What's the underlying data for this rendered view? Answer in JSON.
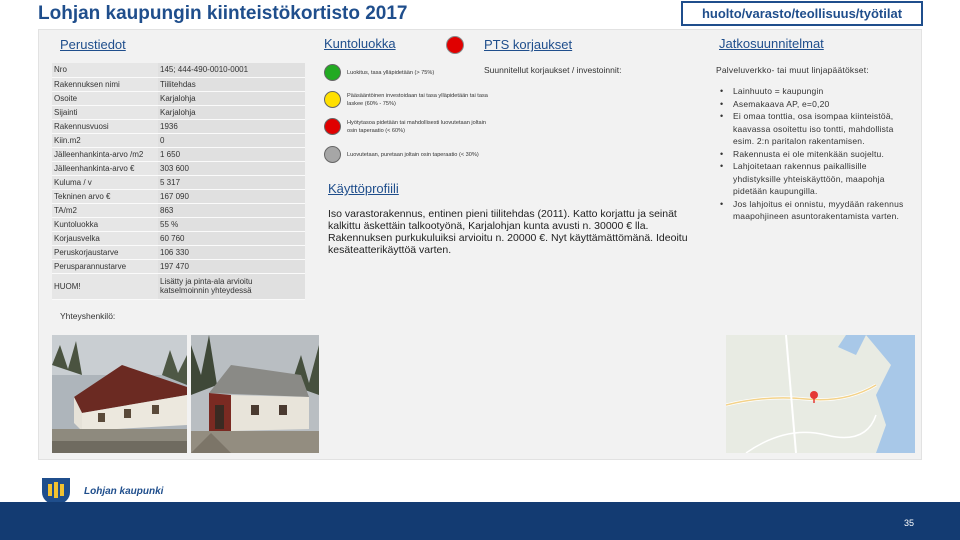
{
  "header": {
    "title": "Lohjan kaupungin kiinteistökortisto 2017",
    "category": "huolto/varasto/teollisuus/työtilat"
  },
  "sections": {
    "basic_info": "Perustiedot",
    "condition": "Kuntoluokka",
    "repairs": "PTS korjaukset",
    "further_planning": "Jatkosuunnitelmat",
    "usage_profile": "Käyttöprofiili",
    "contact": "Yhteyshenkilö:"
  },
  "basic_info": [
    {
      "key": "Nro",
      "value": "145; 444-490-0010-0001"
    },
    {
      "key": "Rakennuksen nimi",
      "value": "Tiilitehdas"
    },
    {
      "key": "Osoite",
      "value": "Karjalohja"
    },
    {
      "key": "Sijainti",
      "value": "Karjalohja"
    },
    {
      "key": "Rakennusvuosi",
      "value": "1936"
    },
    {
      "key": "Kiin.m2",
      "value": "0"
    },
    {
      "key": "Jälleenhankinta-arvo /m2",
      "value": "1 650"
    },
    {
      "key": "Jälleenhankinta-arvo €",
      "value": "303 600"
    },
    {
      "key": "Kuluma / v",
      "value": "5 317"
    },
    {
      "key": "Tekninen arvo €",
      "value": "167 090"
    },
    {
      "key": "TA/m2",
      "value": "863"
    },
    {
      "key": "Kuntoluokka",
      "value": "55 %"
    },
    {
      "key": "Korjausvelka",
      "value": "60 760"
    },
    {
      "key": "Peruskorjaustarve",
      "value": "106 330"
    },
    {
      "key": "Perusparannustarve",
      "value": "197 470"
    },
    {
      "key": "HUOM!",
      "value": "Lisätty ja pinta-ala arvioitu katselmoinnin yhteydessä"
    }
  ],
  "condition_legend": [
    {
      "color": "#22aa22",
      "text": "Luokitus, tasa ylläpidetään (> 75%)"
    },
    {
      "color": "#ffe000",
      "text": "Pääsääntöinen investoidaan tai tasa ylläpidetään tai tasa laskee (60% - 75%)"
    },
    {
      "color": "#e00000",
      "text": "Hyötytasoa pidetään tai mahdollisesti luovutetaan joltain osin taperaatio (< 60%)"
    },
    {
      "color": "#a6a6a6",
      "text": "Luovutetaan, puretaan joltain osin taperaatio (< 30%)"
    }
  ],
  "condition_indicator_color": "#e00000",
  "repairs_text": "Suunnitellut korjaukset / investoinnit:",
  "planning_text": "Palveluverkko- tai muut linjapäätökset:",
  "planning_bullets": [
    "Lainhuuto = kaupungin",
    "Asemakaava AP, e=0,20",
    "Ei omaa tonttia, osa isompaa kiinteistöä, kaavassa osoitettu iso tontti, mahdollista esim. 2:n paritalon rakentamisen.",
    "Rakennusta ei ole mitenkään suojeltu.",
    "Lahjoitetaan rakennus paikallisille yhdistyksille yhteiskäyttöön, maapohja pidetään kaupungilla.",
    "Jos lahjoitus ei onnistu, myydään rakennus maapohjineen asuntorakentamista varten."
  ],
  "usage_profile_paragraphs": [
    "Iso varastorakennus, entinen pieni tiilitehdas (2011). Katto korjattu ja seinät kalkittu äskettäin talkootyönä, Karjalohjan kunta avusti n. 30000 € lla.",
    "Rakennuksen purkukuluiksi arvioitu n. 20000 €. Nyt käyttämättömänä. Ideoitu kesäteatterikäyttöä varten."
  ],
  "footer": {
    "logo_text": "Lohjan kaupunki",
    "page_number": "35"
  }
}
